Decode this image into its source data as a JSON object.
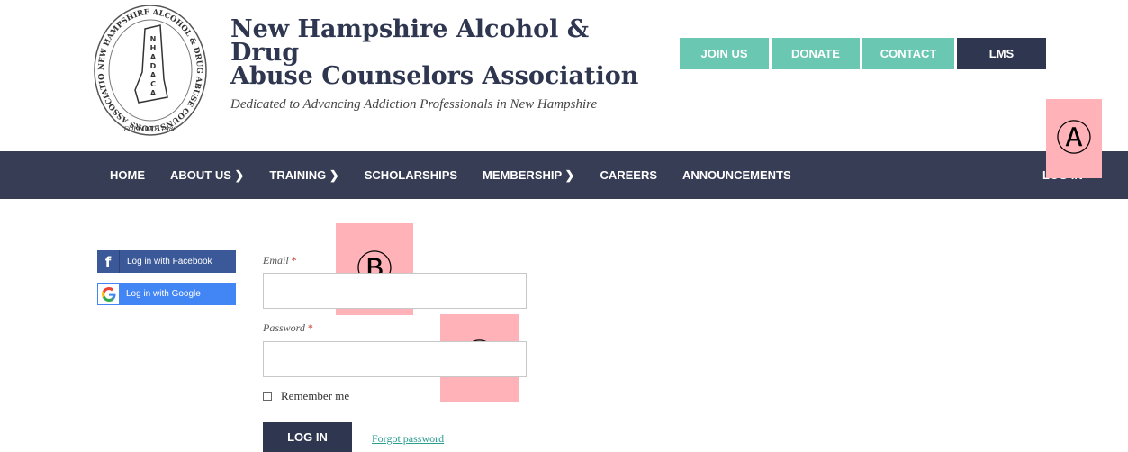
{
  "header": {
    "title_line1": "New Hampshire Alcohol & Drug",
    "title_line2": "Abuse Counselors Association",
    "tagline": "Dedicated to Advancing Addiction Professionals in New Hampshire",
    "logo": {
      "ring_text": "NEW HAMPSHIRE ALCOHOL & DRUG ABUSE COUNSELORS ASSOCIATION",
      "letters": [
        "N",
        "H",
        "A",
        "D",
        "A",
        "C",
        "A"
      ],
      "founded": "FOUNDED 1986"
    }
  },
  "top_buttons": [
    {
      "label": "JOIN US"
    },
    {
      "label": "DONATE"
    },
    {
      "label": "CONTACT"
    },
    {
      "label": "LMS"
    }
  ],
  "nav": {
    "items": [
      {
        "label": "HOME"
      },
      {
        "label": "ABOUT US ❯"
      },
      {
        "label": "TRAINING ❯"
      },
      {
        "label": "SCHOLARSHIPS"
      },
      {
        "label": "MEMBERSHIP ❯"
      },
      {
        "label": "CAREERS"
      },
      {
        "label": "ANNOUNCEMENTS"
      }
    ],
    "login": "LOG IN"
  },
  "markers": {
    "a": "Ⓐ",
    "b": "Ⓑ",
    "c": "Ⓒ"
  },
  "social": {
    "facebook_icon": "f",
    "facebook_label": "Log in with Facebook",
    "google_label": "Log in with Google"
  },
  "form": {
    "email_label": "Email",
    "password_label": "Password",
    "required_mark": "*",
    "remember_label": "Remember me",
    "login_button": "LOG IN",
    "forgot_link": "Forgot password"
  },
  "colors": {
    "navy": "#363d54",
    "teal": "#6ac7b2",
    "facebook": "#3b5998",
    "google": "#4285f4",
    "marker": "#ffb3b8"
  }
}
